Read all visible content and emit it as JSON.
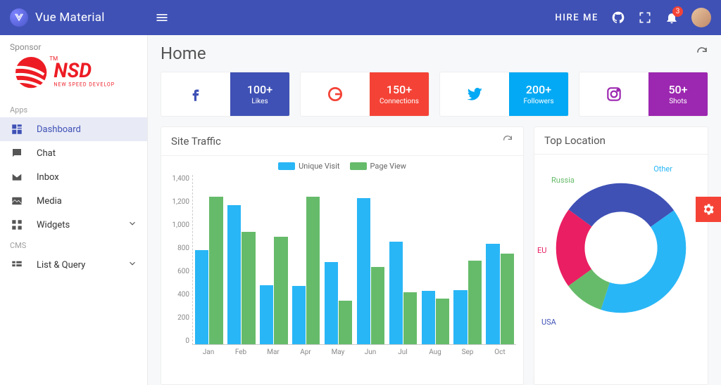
{
  "brand": {
    "title": "Vue Material"
  },
  "top": {
    "hire_label": "HIRE ME",
    "notif_count": "3"
  },
  "sidebar": {
    "sponsor_label": "Sponsor",
    "sponsor_name": "NSD",
    "sponsor_tagline": "NEW SPEED DEVELOP",
    "groups": {
      "apps_label": "Apps",
      "cms_label": "CMS"
    },
    "items": {
      "dashboard": "Dashboard",
      "chat": "Chat",
      "inbox": "Inbox",
      "media": "Media",
      "widgets": "Widgets",
      "list_query": "List & Query"
    }
  },
  "page": {
    "title": "Home"
  },
  "stats": {
    "facebook": {
      "value": "100+",
      "label": "Likes",
      "color": "#3f51b5"
    },
    "google": {
      "value": "150+",
      "label": "Connections",
      "color": "#f44336"
    },
    "twitter": {
      "value": "200+",
      "label": "Followers",
      "color": "#03a9f4"
    },
    "instagram": {
      "value": "50+",
      "label": "Shots",
      "color": "#9c27b0"
    }
  },
  "traffic": {
    "title": "Site Traffic",
    "legend": {
      "unique": "Unique Visit",
      "pageview": "Page View"
    },
    "colors": {
      "unique": "#29b6f6",
      "pageview": "#66bb6a"
    }
  },
  "location": {
    "title": "Top Location",
    "labels": {
      "other": "Other",
      "russia": "Russia",
      "eu": "EU",
      "usa": "USA"
    },
    "colors": {
      "usa": "#3f51b5",
      "other": "#29b6f6",
      "russia": "#66bb6a",
      "eu": "#e91e63"
    }
  },
  "chart_data": [
    {
      "type": "bar",
      "title": "Site Traffic",
      "ylabel": "",
      "ylim": [
        0,
        1400
      ],
      "y_ticks": [
        0,
        200,
        400,
        600,
        800,
        1000,
        1200,
        1400
      ],
      "categories": [
        "Jan",
        "Feb",
        "Mar",
        "Apr",
        "May",
        "Jun",
        "Jul",
        "Aug",
        "Sep",
        "Oct"
      ],
      "series": [
        {
          "name": "Unique Visit",
          "values": [
            780,
            1150,
            490,
            480,
            680,
            1210,
            850,
            440,
            450,
            830
          ]
        },
        {
          "name": "Page View",
          "values": [
            1220,
            930,
            890,
            1220,
            360,
            640,
            430,
            380,
            690,
            750
          ]
        }
      ]
    },
    {
      "type": "pie",
      "title": "Top Location",
      "series": [
        {
          "name": "USA",
          "value": 30
        },
        {
          "name": "Other",
          "value": 40
        },
        {
          "name": "Russia",
          "value": 10
        },
        {
          "name": "EU",
          "value": 20
        }
      ]
    }
  ]
}
